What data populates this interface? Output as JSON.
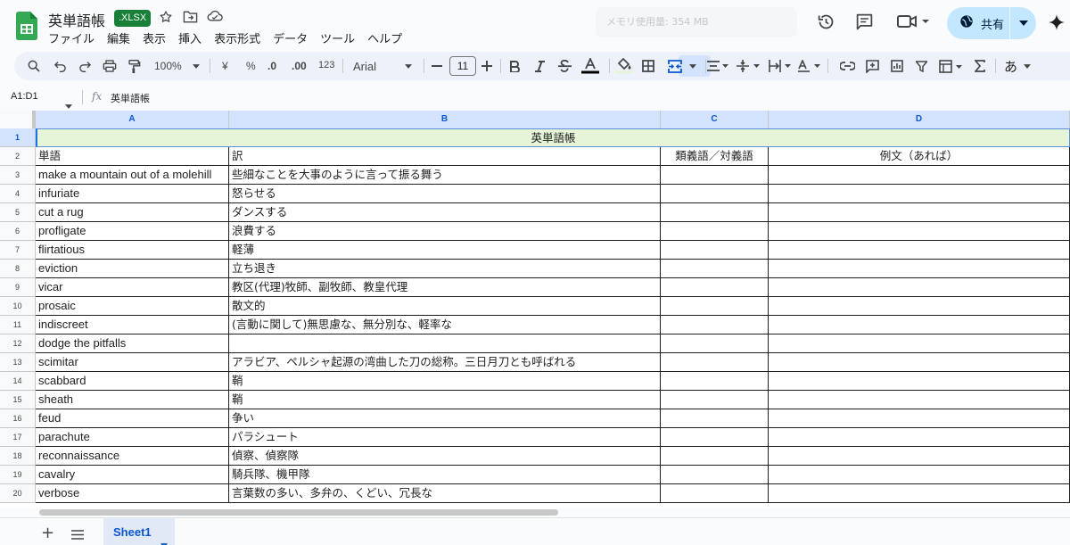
{
  "header": {
    "doc_title": "英単語帳",
    "file_badge": ".XLSX",
    "memory_label": "メモリ使用量: 354 MB",
    "share_label": "共有"
  },
  "menu": [
    "ファイル",
    "編集",
    "表示",
    "挿入",
    "表示形式",
    "データ",
    "ツール",
    "ヘルプ"
  ],
  "toolbar": {
    "zoom": "100%",
    "currency": "¥",
    "percent": "%",
    "decimal_decrease": ".0",
    "decimal_increase": ".00",
    "number_format": "123",
    "font": "Arial",
    "font_size": "11",
    "input_tool": "あ"
  },
  "formula_bar": {
    "range": "A1:D1",
    "fx": "fx",
    "content": "英単語帳"
  },
  "grid": {
    "columns": [
      "A",
      "B",
      "C",
      "D"
    ],
    "title_row": {
      "row": "1",
      "text": "英単語帳"
    },
    "header_row": {
      "row": "2",
      "cells": [
        "単語",
        "訳",
        "類義語／対義語",
        "例文（あれば）"
      ]
    },
    "rows": [
      {
        "row": "3",
        "cells": [
          "make a mountain out of a molehill",
          "些細なことを大事のように言って振る舞う",
          "",
          ""
        ]
      },
      {
        "row": "4",
        "cells": [
          "infuriate",
          "怒らせる",
          "",
          ""
        ]
      },
      {
        "row": "5",
        "cells": [
          "cut a rug",
          "ダンスする",
          "",
          ""
        ]
      },
      {
        "row": "6",
        "cells": [
          "profligate",
          "浪費する",
          "",
          ""
        ]
      },
      {
        "row": "7",
        "cells": [
          "flirtatious",
          "軽薄",
          "",
          ""
        ]
      },
      {
        "row": "8",
        "cells": [
          "eviction",
          "立ち退き",
          "",
          ""
        ]
      },
      {
        "row": "9",
        "cells": [
          "vicar",
          "教区(代理)牧師、副牧師、教皇代理",
          "",
          ""
        ]
      },
      {
        "row": "10",
        "cells": [
          "prosaic",
          "散文的",
          "",
          ""
        ]
      },
      {
        "row": "11",
        "cells": [
          "indiscreet",
          "(言動に関して)無思慮な、無分別な、軽率な",
          "",
          ""
        ]
      },
      {
        "row": "12",
        "cells": [
          "dodge the pitfalls",
          "",
          "",
          ""
        ]
      },
      {
        "row": "13",
        "cells": [
          "scimitar",
          "アラビア、ペルシャ起源の湾曲した刀の総称。三日月刀とも呼ばれる",
          "",
          ""
        ]
      },
      {
        "row": "14",
        "cells": [
          "scabbard",
          "鞘",
          "",
          ""
        ]
      },
      {
        "row": "15",
        "cells": [
          "sheath",
          "鞘",
          "",
          ""
        ]
      },
      {
        "row": "16",
        "cells": [
          "feud",
          "争い",
          "",
          ""
        ]
      },
      {
        "row": "17",
        "cells": [
          "parachute",
          "パラシュート",
          "",
          ""
        ]
      },
      {
        "row": "18",
        "cells": [
          "reconnaissance",
          "偵察、偵察隊",
          "",
          ""
        ]
      },
      {
        "row": "19",
        "cells": [
          "cavalry",
          "騎兵隊、機甲隊",
          "",
          ""
        ]
      },
      {
        "row": "20",
        "cells": [
          "verbose",
          "言葉数の多い、多弁の、くどい、冗長な",
          "",
          ""
        ]
      }
    ]
  },
  "bottom": {
    "add_sheet": "+",
    "sheet_tab": "Sheet1"
  },
  "colors": {
    "accent": "#0b57d0",
    "title_cell_bg": "#e6f4d8",
    "share_bg": "#c2e7ff",
    "badge_bg": "#188038"
  }
}
